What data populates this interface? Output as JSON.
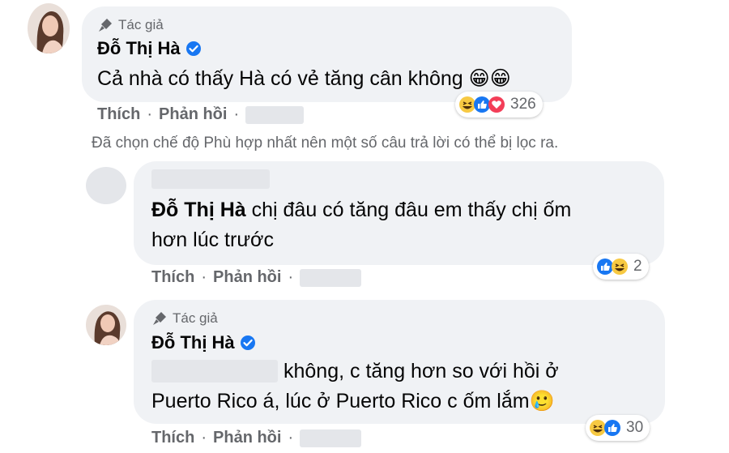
{
  "comment1": {
    "author_tag": "Tác giả",
    "name": "Đỗ Thị Hà",
    "text": "Cả nhà có thấy Hà có vẻ tăng cân không 😁😁",
    "like": "Thích",
    "reply": "Phản hồi",
    "reaction_count": "326"
  },
  "notice": "Đã chọn chế độ Phù hợp nhất nên một số câu trả lời có thể bị lọc ra.",
  "reply1": {
    "mention": "Đỗ Thị Hà",
    "text_line1": " chị đâu có tăng đâu em thấy chị ốm",
    "text_line2": "hơn lúc trước",
    "like": "Thích",
    "reply": "Phản hồi",
    "reaction_count": "2"
  },
  "reply2": {
    "author_tag": "Tác giả",
    "name": "Đỗ Thị Hà",
    "text_line1": "không, c tăng hơn so với hồi ở",
    "text_line2": "Puerto Rico á, lúc ở Puerto Rico c ốm lắm🥲",
    "like": "Thích",
    "reply": "Phản hồi",
    "reaction_count": "30"
  },
  "colors": {
    "bubble": "#f0f2f5",
    "verified": "#1877f2",
    "secondary_text": "#65676b"
  }
}
